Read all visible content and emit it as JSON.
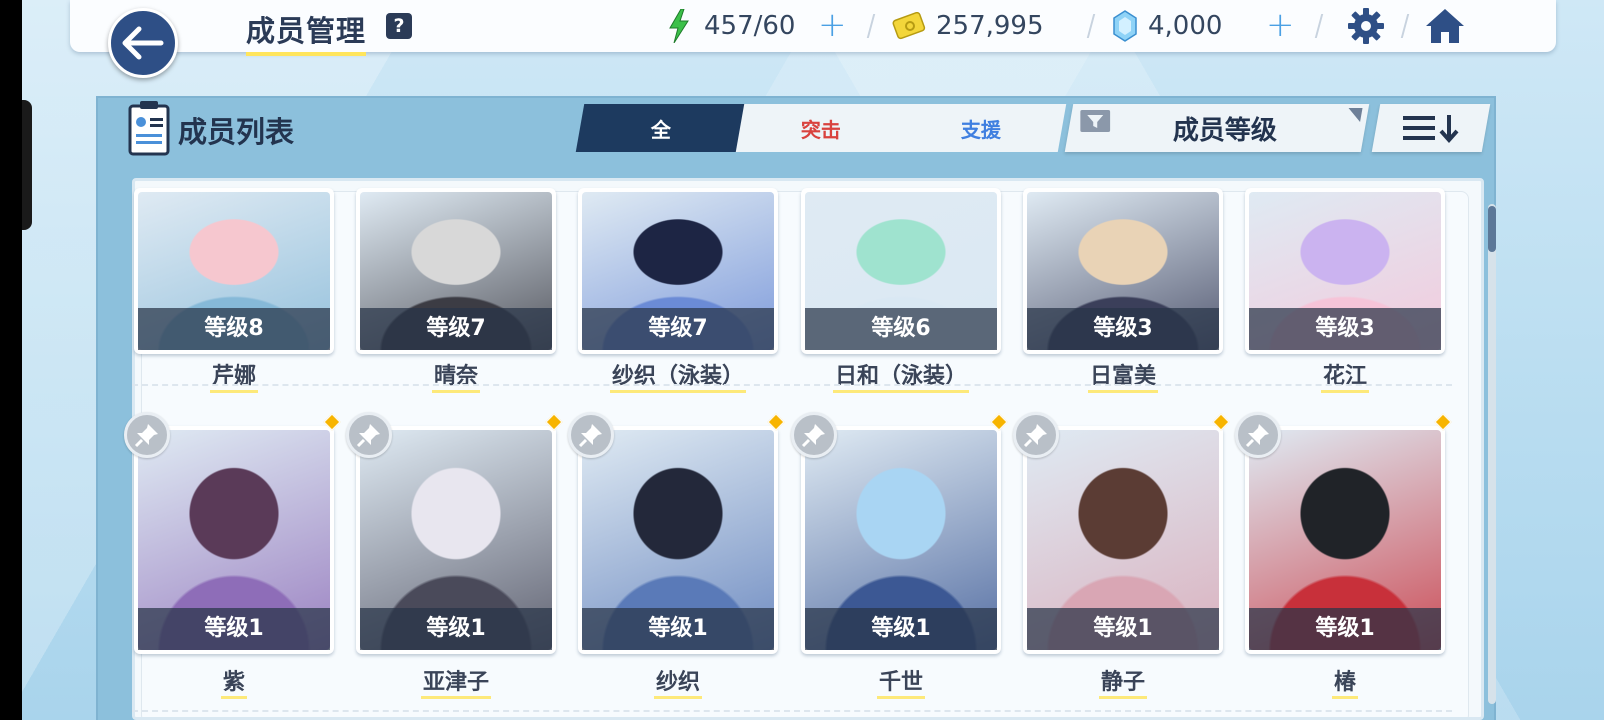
{
  "header": {
    "title": "成员管理",
    "help_label": "?",
    "ap": "457/60",
    "credits": "257,995",
    "gems": "4,000"
  },
  "panel": {
    "title": "成员列表",
    "tabs": [
      {
        "label": "全"
      },
      {
        "label": "突击"
      },
      {
        "label": "支援"
      }
    ],
    "sort_label": "成员等级"
  },
  "members": [
    {
      "name": "芹娜",
      "level": "等级8",
      "palette": [
        "#f6c7cf",
        "#86b9d8"
      ]
    },
    {
      "name": "晴奈",
      "level": "等级7",
      "palette": [
        "#d8d8d8",
        "#3c3c44"
      ]
    },
    {
      "name": "纱织（泳装）",
      "level": "等级7",
      "palette": [
        "#1d2544",
        "#6b8bd6"
      ]
    },
    {
      "name": "日和（泳装）",
      "level": "等级6",
      "palette": [
        "#9fe3cf",
        "#d9e8f3"
      ]
    },
    {
      "name": "日富美",
      "level": "等级3",
      "palette": [
        "#e9d3b6",
        "#3b3f5a"
      ]
    },
    {
      "name": "花江",
      "level": "等级3",
      "palette": [
        "#cbb3f0",
        "#f6c4d8"
      ]
    },
    {
      "name": "紫",
      "level": "等级1",
      "palette": [
        "#5a3a58",
        "#8e6db8"
      ]
    },
    {
      "name": "亚津子",
      "level": "等级1",
      "palette": [
        "#e8e6ef",
        "#4a4a5a"
      ]
    },
    {
      "name": "纱织",
      "level": "等级1",
      "palette": [
        "#23283a",
        "#5a7ab8"
      ]
    },
    {
      "name": "千世",
      "level": "等级1",
      "palette": [
        "#a9d5f3",
        "#3c5894"
      ]
    },
    {
      "name": "静子",
      "level": "等级1",
      "palette": [
        "#5b3c34",
        "#d9a6b4"
      ]
    },
    {
      "name": "椿",
      "level": "等级1",
      "palette": [
        "#202328",
        "#c8303a"
      ]
    }
  ]
}
